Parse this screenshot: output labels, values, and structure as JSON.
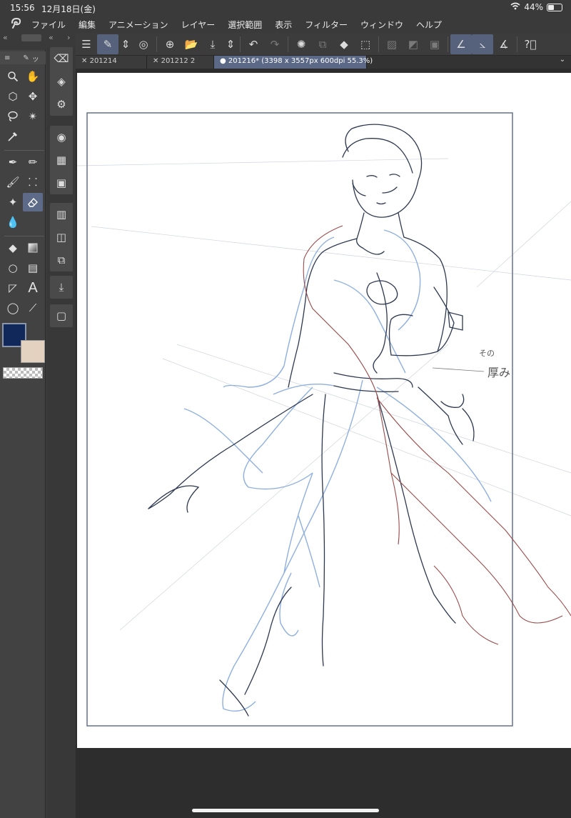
{
  "status": {
    "time": "15:56",
    "date": "12月18日(金)",
    "battery": "44%",
    "battery_level": 0.44
  },
  "menu": {
    "items": [
      "ファイル",
      "編集",
      "アニメーション",
      "レイヤー",
      "選択範囲",
      "表示",
      "フィルター",
      "ウィンドウ",
      "ヘルプ"
    ]
  },
  "tabs": [
    {
      "label": "201214",
      "active": false
    },
    {
      "label": "201212 2",
      "active": false
    },
    {
      "label": "201216* (3398 x 3557px 600dpi 55.3%)",
      "active": true
    }
  ],
  "canvas": {
    "annotation_line1": "その",
    "annotation_line2": "厚み"
  },
  "colors": {
    "accent": "#5b6987",
    "main_color": "#10285a",
    "sub_color": "#e4d2c1"
  }
}
